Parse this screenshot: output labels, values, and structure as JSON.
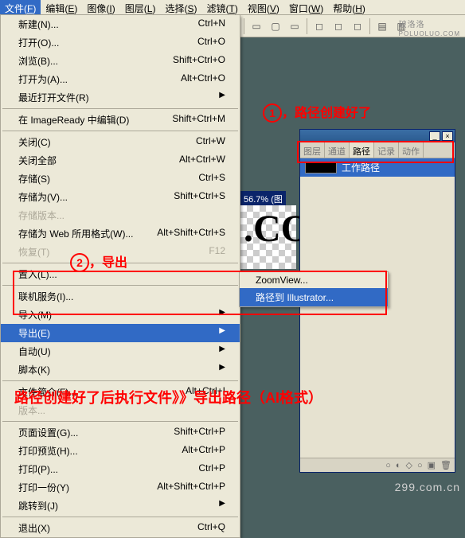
{
  "menubar": {
    "items": [
      {
        "label": "文件",
        "key": "F",
        "active": true
      },
      {
        "label": "编辑",
        "key": "E"
      },
      {
        "label": "图像",
        "key": "I"
      },
      {
        "label": "图层",
        "key": "L"
      },
      {
        "label": "选择",
        "key": "S"
      },
      {
        "label": "滤镜",
        "key": "T"
      },
      {
        "label": "视图",
        "key": "V"
      },
      {
        "label": "窗口",
        "key": "W"
      },
      {
        "label": "帮助",
        "key": "H"
      }
    ]
  },
  "file_menu": [
    {
      "label": "新建(N)...",
      "shortcut": "Ctrl+N"
    },
    {
      "label": "打开(O)...",
      "shortcut": "Ctrl+O"
    },
    {
      "label": "浏览(B)...",
      "shortcut": "Shift+Ctrl+O"
    },
    {
      "label": "打开为(A)...",
      "shortcut": "Alt+Ctrl+O"
    },
    {
      "label": "最近打开文件(R)",
      "arrow": true
    },
    {
      "sep": true
    },
    {
      "label": "在 ImageReady 中编辑(D)",
      "shortcut": "Shift+Ctrl+M"
    },
    {
      "sep": true
    },
    {
      "label": "关闭(C)",
      "shortcut": "Ctrl+W"
    },
    {
      "label": "关闭全部",
      "shortcut": "Alt+Ctrl+W"
    },
    {
      "label": "存储(S)",
      "shortcut": "Ctrl+S"
    },
    {
      "label": "存储为(V)...",
      "shortcut": "Shift+Ctrl+S"
    },
    {
      "label": "存储版本...",
      "disabled": true
    },
    {
      "label": "存储为 Web 所用格式(W)...",
      "shortcut": "Alt+Shift+Ctrl+S"
    },
    {
      "label": "恢复(T)",
      "shortcut": "F12",
      "disabled": true
    },
    {
      "sep": true
    },
    {
      "label": "置入(L)..."
    },
    {
      "sep": true
    },
    {
      "label": "联机服务(I)..."
    },
    {
      "label": "导入(M)",
      "arrow": true
    },
    {
      "label": "导出(E)",
      "arrow": true,
      "highlighted": true
    },
    {
      "label": "自动(U)",
      "arrow": true
    },
    {
      "label": "脚本(K)",
      "arrow": true
    },
    {
      "sep": true
    },
    {
      "label": "文件简介(F)...",
      "shortcut": "Alt+Ctrl+I"
    },
    {
      "label": "版本...",
      "disabled": true
    },
    {
      "sep": true
    },
    {
      "label": "页面设置(G)...",
      "shortcut": "Shift+Ctrl+P"
    },
    {
      "label": "打印预览(H)...",
      "shortcut": "Alt+Ctrl+P"
    },
    {
      "label": "打印(P)...",
      "shortcut": "Ctrl+P"
    },
    {
      "label": "打印一份(Y)",
      "shortcut": "Alt+Shift+Ctrl+P"
    },
    {
      "label": "跳转到(J)",
      "arrow": true
    },
    {
      "sep": true
    },
    {
      "label": "退出(X)",
      "shortcut": "Ctrl+Q"
    }
  ],
  "export_submenu": [
    {
      "label": "ZoomView..."
    },
    {
      "label": "路径到 Illustrator...",
      "highlighted": true
    }
  ],
  "annotations": {
    "a1_num": "1",
    "a1_text": "，路径创建好了",
    "a2_num": "2",
    "a2_text": "，导出",
    "a3_text": "路径创建好了后执行文件》》导出路径（AI格式）"
  },
  "canvas": {
    "title_fragment": "56.7% (图",
    "text_fragment": ".CO"
  },
  "panel": {
    "tabs": [
      "图层",
      "通道",
      "路径",
      "记录",
      "动作"
    ],
    "active_tab": "路径",
    "item": "工作路径",
    "footer_icons": [
      "○",
      "◐",
      "◇",
      "○",
      "▣",
      "🗑"
    ]
  },
  "watermarks": {
    "top": "破洛洛",
    "top_sub": "POLUOLUO.COM",
    "bottom": "299.com.cn"
  }
}
